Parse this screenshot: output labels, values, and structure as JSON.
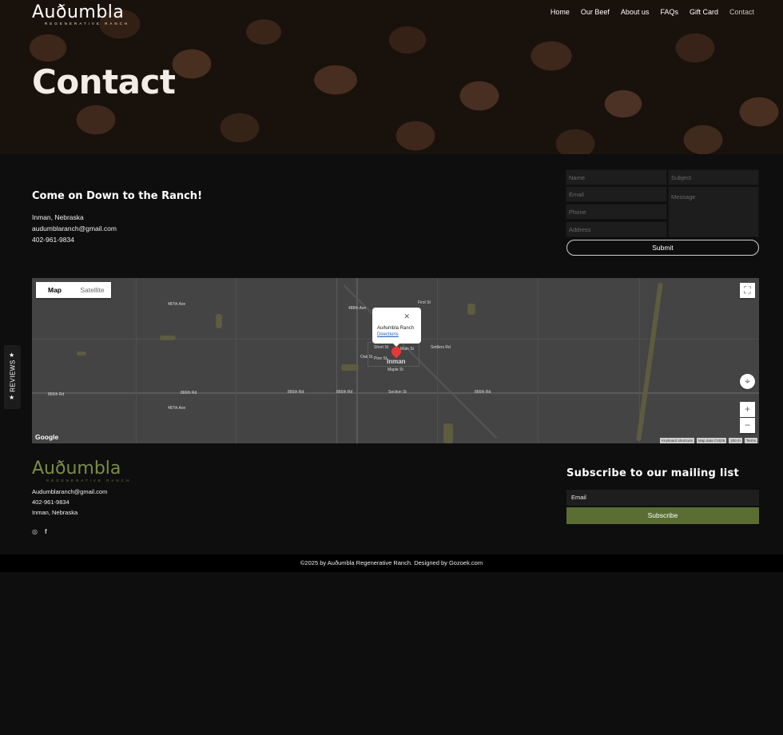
{
  "brand": {
    "name": "Auðumbla",
    "tagline": "REGENERATIVE RANCH"
  },
  "nav": [
    {
      "label": "Home",
      "active": false
    },
    {
      "label": "Our Beef",
      "active": false
    },
    {
      "label": "About us",
      "active": false
    },
    {
      "label": "FAQs",
      "active": false
    },
    {
      "label": "Gift Card",
      "active": false
    },
    {
      "label": "Contact",
      "active": true
    }
  ],
  "hero": {
    "title": "Contact"
  },
  "contact": {
    "heading": "Come on Down to the Ranch!",
    "location": "Inman, Nebraska",
    "email": "audumblaranch@gmail.com",
    "phone": "402-961-9834"
  },
  "form": {
    "name_placeholder": "Name",
    "subject_placeholder": "Subject",
    "email_placeholder": "Email",
    "message_placeholder": "Message",
    "phone_placeholder": "Phone",
    "address_placeholder": "Address",
    "submit_label": "Submit"
  },
  "map": {
    "tab_map": "Map",
    "tab_satellite": "Satellite",
    "popup_title": "Auðumbla Ranch",
    "popup_link": "Directions",
    "town": "Inman",
    "streets": [
      "866th Rd",
      "866th Rd",
      "866th Rd",
      "866th Rd",
      "Section St",
      "866th Rd",
      "Short St",
      "First St",
      "Oak St",
      "Pine St",
      "Maple St",
      "Main St",
      "Settlers Rd",
      "487th Ave",
      "487th Ave",
      "488th Ave"
    ],
    "google_label": "Google",
    "keyboard_label": "Keyboard shortcuts",
    "mapdata_label": "Map data ©2025",
    "scale_label": "200 m",
    "terms_label": "Terms"
  },
  "reviews_tab": {
    "label": "REVIEWS"
  },
  "footer": {
    "email": "Audumblaranch@gmail.com",
    "phone": "402-961-9834",
    "location": "Inman, Nebraska",
    "subscribe_title": "Subscribe to our mailing list",
    "email_placeholder": "Email",
    "subscribe_label": "Subscribe",
    "copyright": "©2025 by Auðumbla Regenerative Ranch. Designed by Gozoek.com"
  },
  "colors": {
    "background": "#0e0e0e",
    "accent_green": "#5a6e34",
    "logo_green": "#7c8c45"
  },
  "icons": [
    "instagram-icon",
    "facebook-icon",
    "star-icon",
    "fullscreen-icon",
    "location-target-icon",
    "zoom-in-icon",
    "zoom-out-icon",
    "close-icon"
  ]
}
